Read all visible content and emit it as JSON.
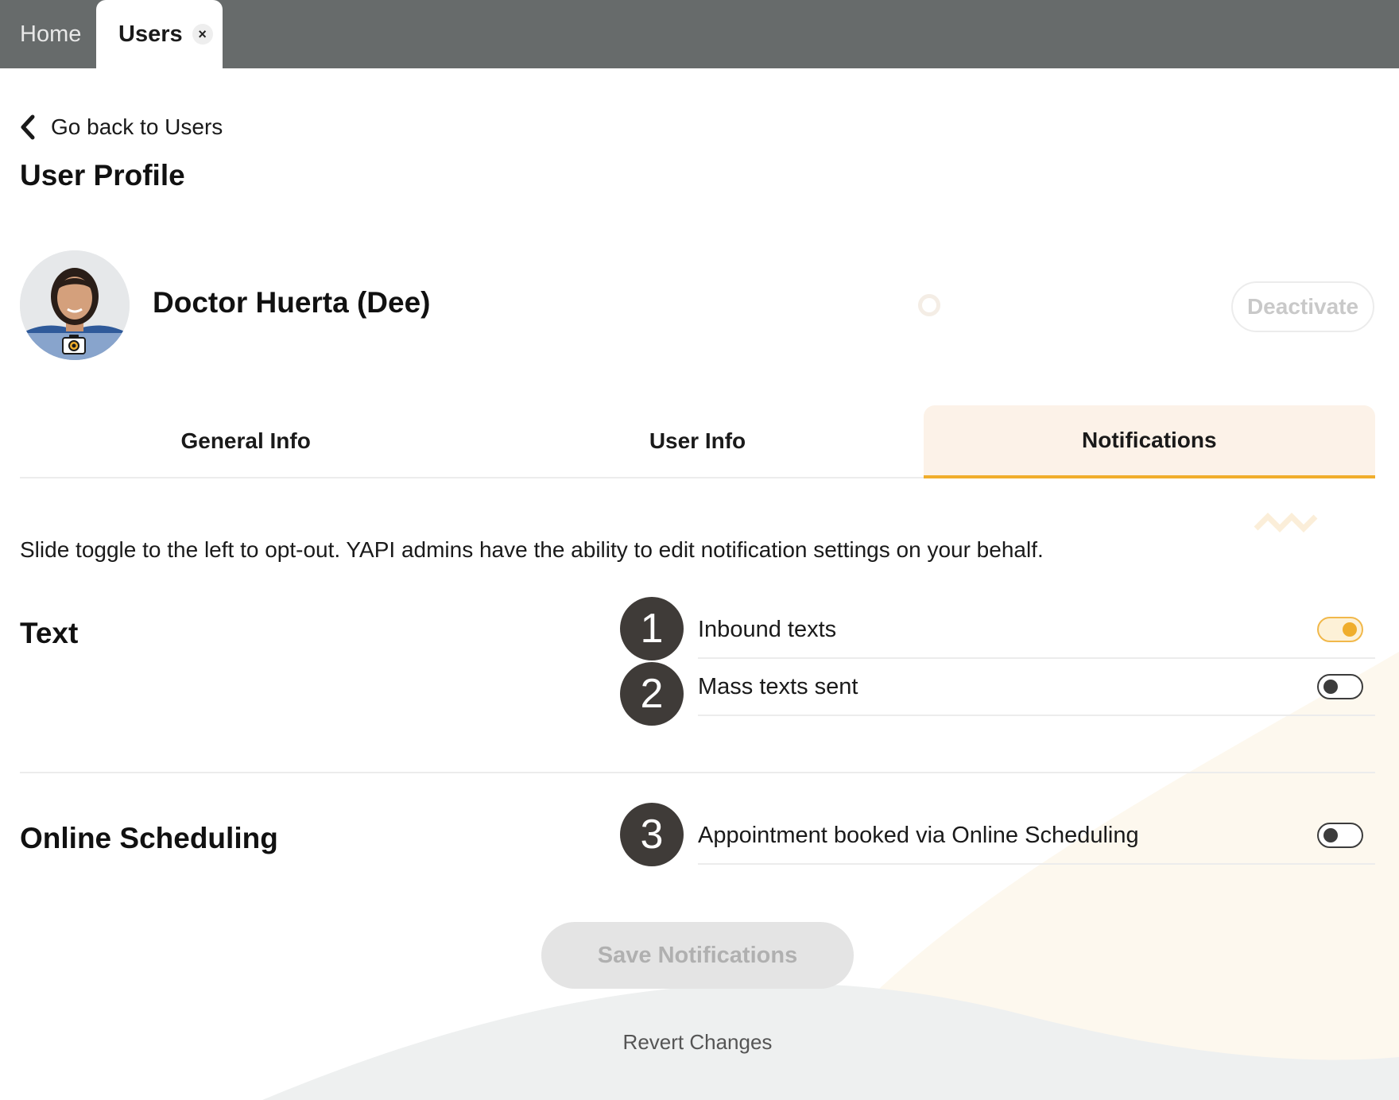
{
  "top_tabs": {
    "home_label": "Home",
    "users_label": "Users",
    "close_glyph": "×"
  },
  "back_link": {
    "label": "Go back to Users"
  },
  "page_title": "User Profile",
  "profile": {
    "name": "Doctor Huerta (Dee)",
    "deactivate_label": "Deactivate"
  },
  "tabs": [
    {
      "label": "General Info",
      "active": false
    },
    {
      "label": "User Info",
      "active": false
    },
    {
      "label": "Notifications",
      "active": true
    }
  ],
  "intro_text": "Slide toggle to the left to opt-out. YAPI admins have the ability to edit notification settings on your behalf.",
  "sections": [
    {
      "title": "Text",
      "items": [
        {
          "number": "1",
          "label": "Inbound texts",
          "enabled": true
        },
        {
          "number": "2",
          "label": "Mass texts sent",
          "enabled": false
        }
      ]
    },
    {
      "title": "Online Scheduling",
      "items": [
        {
          "number": "3",
          "label": "Appointment booked via Online Scheduling",
          "enabled": false
        }
      ]
    }
  ],
  "actions": {
    "save_label": "Save Notifications",
    "revert_label": "Revert Changes"
  },
  "colors": {
    "topbar": "#676b6b",
    "accent": "#f0ae2c",
    "active_tab_bg": "#fcf2e8",
    "badge": "#3f3b38"
  }
}
